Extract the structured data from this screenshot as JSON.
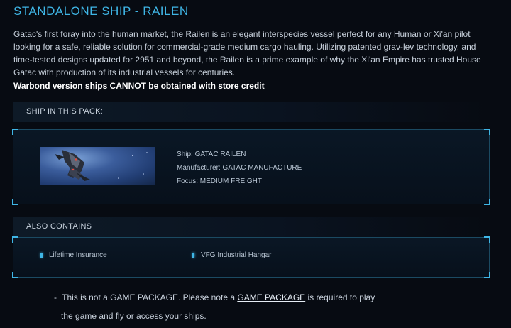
{
  "header": {
    "title": "STANDALONE SHIP - RAILEN"
  },
  "description": {
    "text": "Gatac's first foray into the human market, the Railen is an elegant interspecies vessel perfect for any Human or Xi'an pilot looking for a safe, reliable solution for commercial-grade medium cargo hauling. Utilizing patented grav-lev technology, and time-tested designs updated for 2951 and beyond, the Railen is a prime example of why the Xi'an Empire has trusted House Gatac with production of its industrial vessels for centuries.",
    "warning": "Warbond version ships CANNOT be obtained with store credit"
  },
  "ship_section": {
    "label": "SHIP IN THIS PACK:",
    "ship": "Ship: GATAC RAILEN",
    "manufacturer": "Manufacturer: GATAC MANUFACTURE",
    "focus": "Focus: MEDIUM FREIGHT"
  },
  "contains_section": {
    "label": "ALSO CONTAINS",
    "items": [
      "Lifetime Insurance",
      "VFG Industrial Hangar"
    ]
  },
  "note": {
    "dash": "-",
    "before": "This is not a GAME PACKAGE. Please note a",
    "link": "GAME PACKAGE",
    "after": "is required to play",
    "line2": "the game and fly or access your ships."
  },
  "colors": {
    "accent": "#3fb6e6",
    "background": "#070b12",
    "panel_border": "#1b4a62"
  },
  "icons": {
    "bullet": "bullet-icon",
    "ship": "ship-thumbnail"
  }
}
